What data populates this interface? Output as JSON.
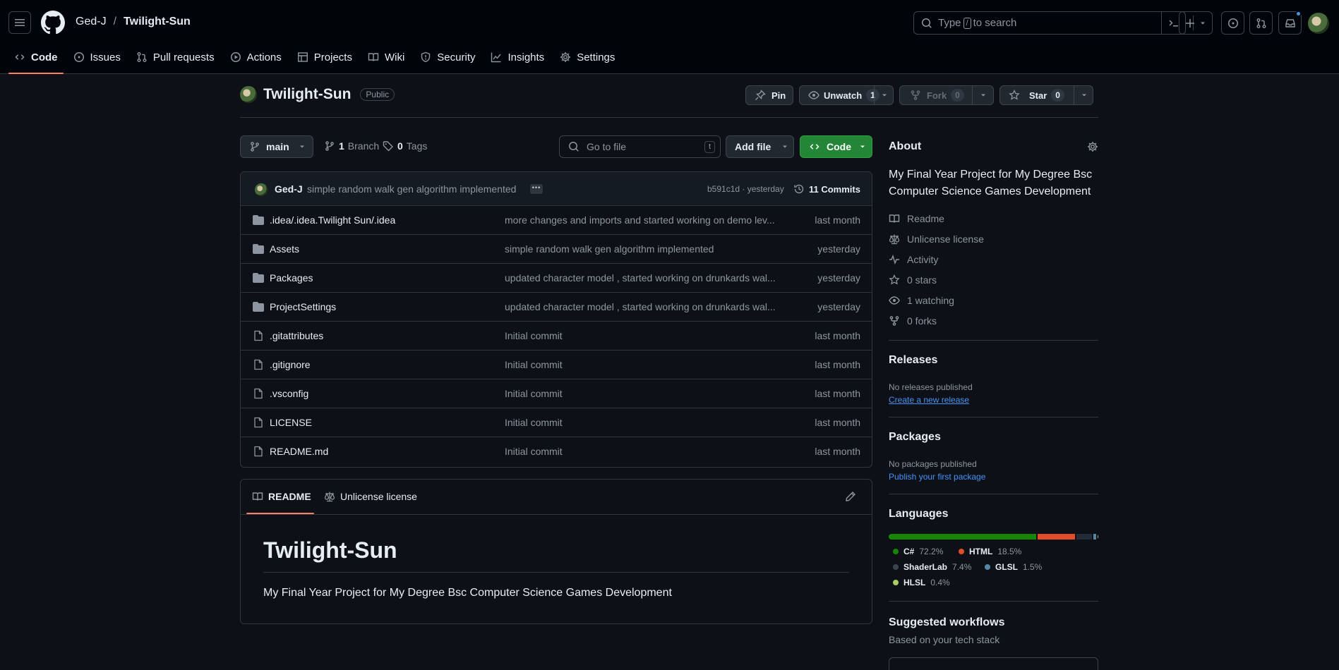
{
  "header": {
    "owner": "Ged-J",
    "separator": "/",
    "repo": "Twilight-Sun",
    "search_prefix": "Type",
    "search_key": "/",
    "search_suffix": "to search"
  },
  "nav": [
    {
      "label": "Code",
      "icon": "code-icon"
    },
    {
      "label": "Issues",
      "icon": "issue-opened-icon"
    },
    {
      "label": "Pull requests",
      "icon": "git-pull-request-icon"
    },
    {
      "label": "Actions",
      "icon": "play-icon"
    },
    {
      "label": "Projects",
      "icon": "table-icon"
    },
    {
      "label": "Wiki",
      "icon": "book-icon"
    },
    {
      "label": "Security",
      "icon": "shield-icon"
    },
    {
      "label": "Insights",
      "icon": "graph-icon"
    },
    {
      "label": "Settings",
      "icon": "gear-icon"
    }
  ],
  "repo_head": {
    "name": "Twilight-Sun",
    "visibility": "Public",
    "pin": "Pin",
    "unwatch": "Unwatch",
    "watch_count": "1",
    "fork": "Fork",
    "fork_count": "0",
    "star": "Star",
    "star_count": "0"
  },
  "toolbar": {
    "branch": "main",
    "branch_count": "1",
    "branch_label": "Branch",
    "tag_count": "0",
    "tag_label": "Tags",
    "goto_placeholder": "Go to file",
    "goto_key": "t",
    "add_file": "Add file",
    "code": "Code"
  },
  "latest_commit": {
    "author": "Ged-J",
    "message": "simple random walk gen algorithm implemented",
    "ellipsis": "•••",
    "sha_time": "b591c1d · yesterday",
    "commits": "11 Commits"
  },
  "files": [
    {
      "type": "dir",
      "name": ".idea/.idea.Twilight Sun/.idea",
      "message": "more changes and imports and started working on demo lev...",
      "date": "last month"
    },
    {
      "type": "dir",
      "name": "Assets",
      "message": "simple random walk gen algorithm implemented",
      "date": "yesterday"
    },
    {
      "type": "dir",
      "name": "Packages",
      "message": "updated character model , started working on drunkards wal...",
      "date": "yesterday"
    },
    {
      "type": "dir",
      "name": "ProjectSettings",
      "message": "updated character model , started working on drunkards wal...",
      "date": "yesterday"
    },
    {
      "type": "file",
      "name": ".gitattributes",
      "message": "Initial commit",
      "date": "last month"
    },
    {
      "type": "file",
      "name": ".gitignore",
      "message": "Initial commit",
      "date": "last month"
    },
    {
      "type": "file",
      "name": ".vsconfig",
      "message": "Initial commit",
      "date": "last month"
    },
    {
      "type": "file",
      "name": "LICENSE",
      "message": "Initial commit",
      "date": "last month"
    },
    {
      "type": "file",
      "name": "README.md",
      "message": "Initial commit",
      "date": "last month"
    }
  ],
  "readme": {
    "tab_readme": "README",
    "tab_license": "Unlicense license",
    "title": "Twilight-Sun",
    "body": "My Final Year Project for My Degree Bsc Computer Science Games Development"
  },
  "about": {
    "title": "About",
    "description": "My Final Year Project for My Degree Bsc Computer Science Games Development",
    "readme": "Readme",
    "license": "Unlicense license",
    "activity": "Activity",
    "stars": "0 stars",
    "watching": "1 watching",
    "forks": "0 forks"
  },
  "releases": {
    "title": "Releases",
    "empty": "No releases published",
    "link": "Create a new release"
  },
  "packages": {
    "title": "Packages",
    "empty": "No packages published",
    "link": "Publish your first package"
  },
  "languages": {
    "title": "Languages",
    "items": [
      {
        "name": "C#",
        "percent": "72.2%",
        "value": 72.2,
        "color": "#178600"
      },
      {
        "name": "HTML",
        "percent": "18.5%",
        "value": 18.5,
        "color": "#e34c26"
      },
      {
        "name": "ShaderLab",
        "percent": "7.4%",
        "value": 7.4,
        "color": "#222c37"
      },
      {
        "name": "GLSL",
        "percent": "1.5%",
        "value": 1.5,
        "color": "#5686a5"
      },
      {
        "name": "HLSL",
        "percent": "0.4%",
        "value": 0.4,
        "color": "#aace60"
      }
    ]
  },
  "workflows": {
    "title": "Suggested workflows",
    "subtitle": "Based on your tech stack"
  },
  "colors": {
    "accent_green": "#238636",
    "tab_underline": "#f78166",
    "link_blue": "#4493f8"
  }
}
